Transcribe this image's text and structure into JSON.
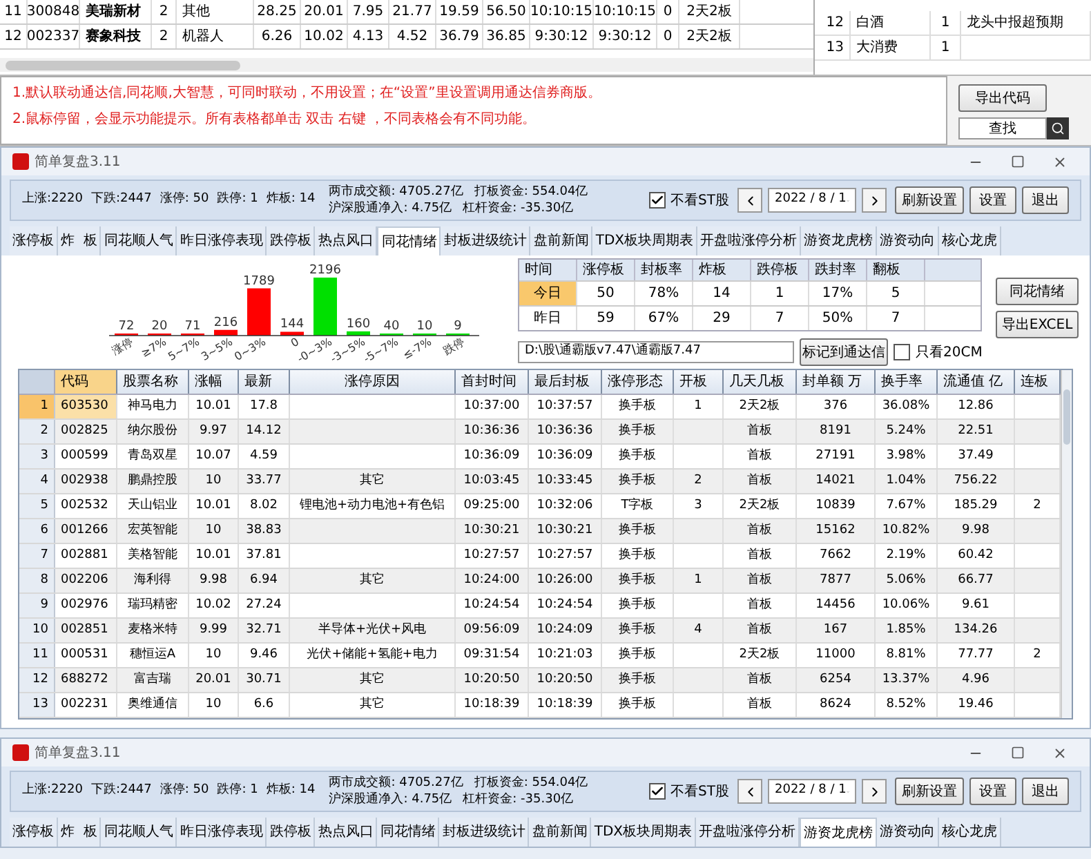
{
  "top_table": {
    "rows": [
      {
        "cells": [
          "11",
          "300848",
          "美瑞新材",
          "2",
          "其他",
          "28.25",
          "20.01",
          "7.95",
          "21.77",
          "19.59",
          "56.50",
          "10:10:15",
          "10:10:15",
          "0",
          "2天2板"
        ]
      },
      {
        "cells": [
          "12",
          "002337",
          "赛象科技",
          "2",
          "机器人",
          "6.26",
          "10.02",
          "4.13",
          "4.52",
          "36.79",
          "36.85",
          "9:30:12",
          "9:30:12",
          "0",
          "2天2板"
        ]
      }
    ]
  },
  "side_table": {
    "rows": [
      {
        "cells": [
          "12",
          "白酒",
          "1",
          "龙头中报超预期"
        ]
      },
      {
        "cells": [
          "13",
          "大消费",
          "1"
        ]
      }
    ]
  },
  "notes": [
    "1.默认联动通达信,同花顺,大智慧，可同时联动，不用设置；在“设置”里设置调用通达信券商版。",
    "2.鼠标停留，会显示功能提示。所有表格都单击 双击 右键 ，不同表格会有不同功能。"
  ],
  "note_buttons": {
    "export": "导出代码",
    "find": "查找"
  },
  "main_window": {
    "title": "简单复盘3.11",
    "stats": [
      "上涨:2220",
      "下跌:2447",
      "涨停: 50",
      "跌停: 1",
      "炸板: 14"
    ],
    "market": [
      [
        "两市成交额: 4705.27亿",
        "打板资金: 554.04亿"
      ],
      [
        "沪深股通净入: 4.75亿",
        "杠杆资金: -35.30亿"
      ]
    ],
    "st_filter": {
      "label": "不看ST股",
      "checked": true
    },
    "date": "2022 / 8 / 1",
    "buttons": [
      "刷新设置",
      "设置",
      "退出"
    ],
    "tabs": [
      {
        "label": "涨停板",
        "selected": false
      },
      {
        "label": "炸  板",
        "selected": false
      },
      {
        "label": "同花顺人气",
        "selected": false
      },
      {
        "label": "昨日涨停表现",
        "selected": false
      },
      {
        "label": "跌停板",
        "selected": false
      },
      {
        "label": "热点风口",
        "selected": false
      },
      {
        "label": "同花情绪",
        "selected": true
      },
      {
        "label": "封板进级统计",
        "selected": false
      },
      {
        "label": "盘前新闻",
        "selected": false
      },
      {
        "label": "TDX板块周期表",
        "selected": false
      },
      {
        "label": "开盘啦涨停分析",
        "selected": false
      },
      {
        "label": "游资龙虎榜",
        "selected": false
      },
      {
        "label": "游资动向",
        "selected": false
      },
      {
        "label": "核心龙虎",
        "selected": false
      }
    ],
    "chart_data": {
      "type": "bar",
      "categories": [
        "涨停",
        "≥7%",
        "5~7%",
        "3~5%",
        "0~3%",
        "0",
        "-0~3%",
        "-3~5%",
        "-5~7%",
        "≤-7%",
        "跌停"
      ],
      "stacked": true,
      "data_labels": true,
      "series": [
        {
          "color": "#ff0000",
          "values": [
            72,
            20,
            71,
            216,
            1789,
            144,
            null,
            null,
            null,
            null,
            null
          ]
        },
        {
          "color": "#00e000",
          "values": [
            null,
            null,
            null,
            null,
            null,
            null,
            2196,
            160,
            40,
            10,
            9
          ]
        }
      ]
    },
    "stat_table": {
      "columns": [
        "时间",
        "涨停板",
        "封板率",
        "炸板",
        "跌停板",
        "跌封率",
        "翻板"
      ],
      "rows": [
        {
          "selected": true,
          "cells": [
            "今日",
            "50",
            "78%",
            "14",
            "1",
            "17%",
            "5"
          ]
        },
        {
          "selected": false,
          "cells": [
            "昨日",
            "59",
            "67%",
            "29",
            "7",
            "50%",
            "7"
          ]
        }
      ]
    },
    "side_buttons": [
      "同花情绪",
      "导出EXCEL"
    ],
    "path": "D:\\股\\通霸版v7.47\\通霸版7.47",
    "mark_button": "标记到通达信",
    "cm_filter": {
      "label": "只看20CM",
      "checked": false
    },
    "table": {
      "columns": [
        "代码",
        "股票名称",
        "涨幅",
        "最新",
        "涨停原因",
        "首封时间",
        "最后封板",
        "涨停形态",
        "开板",
        "几天几板",
        "封单额 万",
        "换手率",
        "流通值 亿",
        "连板"
      ],
      "rows": [
        {
          "selected": true,
          "num": "1",
          "cells": [
            "603530",
            "神马电力",
            "10.01",
            "17.8",
            "",
            "10:37:00",
            "10:37:57",
            "换手板",
            "1",
            "2天2板",
            "376",
            "36.08%",
            "12.86",
            ""
          ]
        },
        {
          "selected": false,
          "num": "2",
          "cells": [
            "002825",
            "纳尔股份",
            "9.97",
            "14.12",
            "",
            "10:36:36",
            "10:36:36",
            "换手板",
            "",
            "首板",
            "8191",
            "5.24%",
            "22.51",
            ""
          ]
        },
        {
          "selected": false,
          "num": "3",
          "cells": [
            "000599",
            "青岛双星",
            "10.07",
            "4.59",
            "",
            "10:36:09",
            "10:36:09",
            "换手板",
            "",
            "首板",
            "27191",
            "3.98%",
            "37.49",
            ""
          ]
        },
        {
          "selected": false,
          "num": "4",
          "cells": [
            "002938",
            "鹏鼎控股",
            "10",
            "33.77",
            "其它",
            "10:03:45",
            "10:33:45",
            "换手板",
            "2",
            "首板",
            "14021",
            "1.04%",
            "756.22",
            ""
          ]
        },
        {
          "selected": false,
          "num": "5",
          "cells": [
            "002532",
            "天山铝业",
            "10.01",
            "8.02",
            "锂电池+动力电池+有色铝",
            "09:25:00",
            "10:32:06",
            "T字板",
            "3",
            "2天2板",
            "10839",
            "7.67%",
            "185.29",
            "2"
          ]
        },
        {
          "selected": false,
          "num": "6",
          "cells": [
            "001266",
            "宏英智能",
            "10",
            "38.83",
            "",
            "10:30:21",
            "10:30:21",
            "换手板",
            "",
            "首板",
            "15162",
            "10.82%",
            "9.98",
            ""
          ]
        },
        {
          "selected": false,
          "num": "7",
          "cells": [
            "002881",
            "美格智能",
            "10.01",
            "37.81",
            "",
            "10:27:57",
            "10:27:57",
            "换手板",
            "",
            "首板",
            "7662",
            "2.19%",
            "60.42",
            ""
          ]
        },
        {
          "selected": false,
          "num": "8",
          "cells": [
            "002206",
            "海利得",
            "9.98",
            "6.94",
            "其它",
            "10:24:00",
            "10:26:00",
            "换手板",
            "1",
            "首板",
            "7877",
            "5.06%",
            "66.77",
            ""
          ]
        },
        {
          "selected": false,
          "num": "9",
          "cells": [
            "002976",
            "瑞玛精密",
            "10.02",
            "27.24",
            "",
            "10:24:54",
            "10:24:54",
            "换手板",
            "",
            "首板",
            "14456",
            "10.06%",
            "9.61",
            ""
          ]
        },
        {
          "selected": false,
          "num": "10",
          "cells": [
            "002851",
            "麦格米特",
            "9.99",
            "32.71",
            "半导体+光伏+风电",
            "09:56:09",
            "10:24:09",
            "换手板",
            "4",
            "首板",
            "167",
            "1.85%",
            "134.26",
            ""
          ]
        },
        {
          "selected": false,
          "num": "11",
          "cells": [
            "000531",
            "穗恒运A",
            "10",
            "9.46",
            "光伏+储能+氢能+电力",
            "09:31:54",
            "10:21:03",
            "换手板",
            "",
            "2天2板",
            "11000",
            "8.81%",
            "77.77",
            "2"
          ]
        },
        {
          "selected": false,
          "num": "12",
          "cells": [
            "688272",
            "富吉瑞",
            "20.01",
            "30.71",
            "其它",
            "10:20:50",
            "10:20:50",
            "换手板",
            "",
            "首板",
            "6254",
            "13.37%",
            "4.96",
            ""
          ]
        },
        {
          "selected": false,
          "num": "13",
          "cells": [
            "002231",
            "奥维通信",
            "10",
            "6.6",
            "其它",
            "10:18:39",
            "10:18:39",
            "换手板",
            "",
            "首板",
            "8624",
            "8.52%",
            "19.46",
            ""
          ]
        }
      ]
    }
  },
  "bottom_window": {
    "title": "简单复盘3.11",
    "stats": [
      "上涨:2220",
      "下跌:2447",
      "涨停: 50",
      "跌停: 1",
      "炸板: 14"
    ],
    "market": [
      [
        "两市成交额: 4705.27亿",
        "打板资金: 554.04亿"
      ],
      [
        "沪深股通净入: 4.75亿",
        "杠杆资金: -35.30亿"
      ]
    ],
    "st_filter": {
      "label": "不看ST股",
      "checked": true
    },
    "date": "2022 / 8 / 1",
    "buttons": [
      "刷新设置",
      "设置",
      "退出"
    ],
    "tabs": [
      {
        "label": "涨停板",
        "selected": false
      },
      {
        "label": "炸  板",
        "selected": false
      },
      {
        "label": "同花顺人气",
        "selected": false
      },
      {
        "label": "昨日涨停表现",
        "selected": false
      },
      {
        "label": "跌停板",
        "selected": false
      },
      {
        "label": "热点风口",
        "selected": false
      },
      {
        "label": "同花情绪",
        "selected": false
      },
      {
        "label": "封板进级统计",
        "selected": false
      },
      {
        "label": "盘前新闻",
        "selected": false
      },
      {
        "label": "TDX板块周期表",
        "selected": false
      },
      {
        "label": "开盘啦涨停分析",
        "selected": false
      },
      {
        "label": "游资龙虎榜",
        "selected": true
      },
      {
        "label": "游资动向",
        "selected": false
      },
      {
        "label": "核心龙虎",
        "selected": false
      }
    ]
  }
}
